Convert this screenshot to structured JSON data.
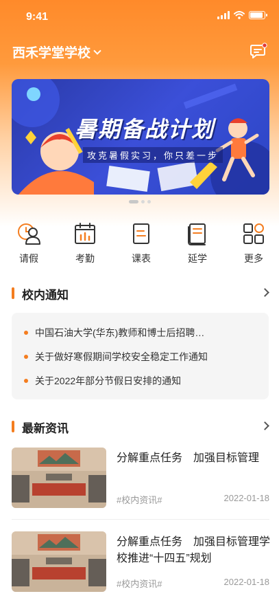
{
  "status_bar": {
    "time": "9:41"
  },
  "header": {
    "school_name": "西禾学堂学校"
  },
  "banner": {
    "title": "暑期备战计划",
    "subtitle": "攻克暑假实习，你只差一步",
    "pages": 3,
    "active_page": 1
  },
  "quick_actions": [
    {
      "label": "请假",
      "icon": "leave-icon"
    },
    {
      "label": "考勤",
      "icon": "attendance-icon"
    },
    {
      "label": "课表",
      "icon": "schedule-icon"
    },
    {
      "label": "延学",
      "icon": "extended-study-icon"
    },
    {
      "label": "更多",
      "icon": "more-grid-icon"
    }
  ],
  "notices": {
    "title": "校内通知",
    "items": [
      "中国石油大学(华东)教师和博士后招聘…",
      "关于做好寒假期间学校安全稳定工作通知",
      "关于2022年部分节假日安排的通知"
    ]
  },
  "news": {
    "title": "最新资讯",
    "items": [
      {
        "title": "分解重点任务　加强目标管理",
        "tag": "#校内资讯#",
        "date": "2022-01-18"
      },
      {
        "title": "分解重点任务　加强目标管理学校推进“十四五”规划",
        "tag": "#校内资讯#",
        "date": "2022-01-18"
      }
    ]
  },
  "colors": {
    "accent": "#f47d1f",
    "header_gradient_top": "#ff8a2a",
    "banner_blue": "#2b45c4"
  }
}
